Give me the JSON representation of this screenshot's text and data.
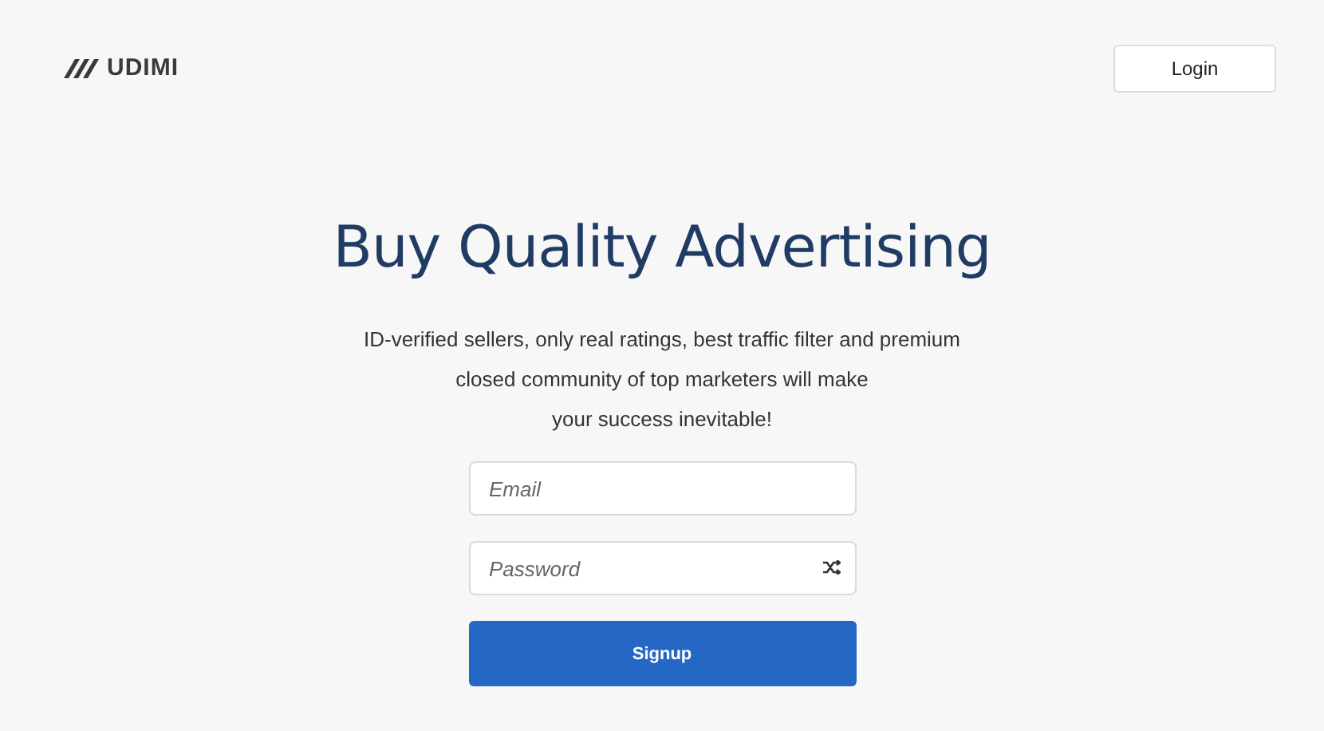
{
  "header": {
    "logo": "UDIMI",
    "login_button": "Login"
  },
  "hero": {
    "title": "Buy Quality Advertising",
    "description_lines": [
      "ID-verified sellers, only real ratings, best traffic filter and premium",
      "closed community of top marketers will make",
      "your success inevitable!"
    ]
  },
  "form": {
    "email": {
      "placeholder": "Email"
    },
    "password": {
      "placeholder": "Password"
    },
    "submit": "Signup"
  }
}
